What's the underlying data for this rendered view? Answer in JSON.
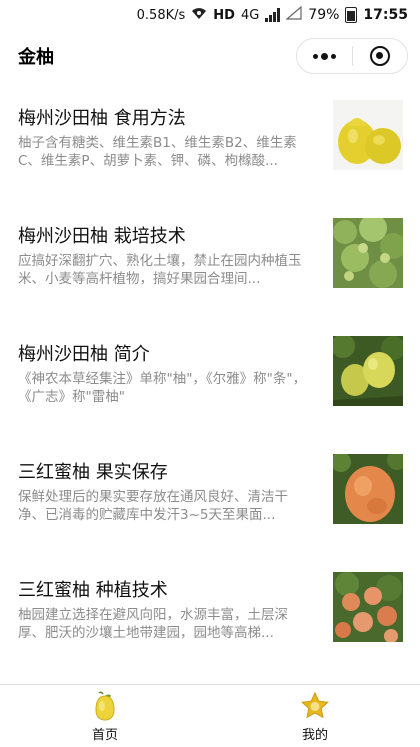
{
  "status_bar": {
    "network_speed": "0.58K/s",
    "hd_label": "HD",
    "network_type": "4G",
    "battery": "79%",
    "time": "17:55"
  },
  "nav": {
    "title": "金柚"
  },
  "articles": [
    {
      "title": "梅州沙田柚 食用方法",
      "summary": "柚子含有糖类、维生素B1、维生素B2、维生素C、维生素P、胡萝卜素、钾、磷、枸橼酸...",
      "image": "pomelo-fruit-image"
    },
    {
      "title": "梅州沙田柚 栽培技术",
      "summary": "应搞好深翻扩穴、熟化土壤，禁止在园内种植玉米、小麦等高杆植物，搞好果园合理间...",
      "image": "pomelo-orchard-image"
    },
    {
      "title": "梅州沙田柚 简介",
      "summary": "《神农本草经集注》单称\"柚\"，《尔雅》称\"条\"，《广志》称\"雷柚\"",
      "image": "pomelo-tree-image"
    },
    {
      "title": "三红蜜柚 果实保存",
      "summary": "保鲜处理后的果实要存放在通风良好、清洁干净、已消毒的贮藏库中发汗3~5天至果面...",
      "image": "red-pomelo-image"
    },
    {
      "title": "三红蜜柚 种植技术",
      "summary": "柚园建立选择在避风向阳，水源丰富，土层深厚、肥沃的沙壤土地带建园，园地等高梯...",
      "image": "red-pomelo-tree-image"
    }
  ],
  "tab_bar": {
    "tabs": [
      {
        "label": "首页",
        "icon": "pomelo-icon"
      },
      {
        "label": "我的",
        "icon": "star-badge-icon"
      }
    ]
  },
  "colors": {
    "summary_text": "#8c8c8c",
    "pomelo_yellow": "#e9d23a",
    "star_gold": "#e8b81f"
  }
}
